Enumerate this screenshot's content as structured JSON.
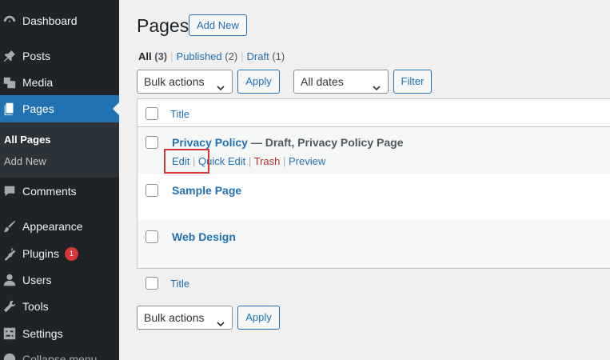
{
  "sidebar": {
    "items": [
      {
        "label": "Dashboard",
        "icon": "dashboard-icon"
      },
      {
        "label": "Posts",
        "icon": "pushpin-icon"
      },
      {
        "label": "Media",
        "icon": "media-icon"
      },
      {
        "label": "Pages",
        "icon": "pages-icon",
        "active": true
      },
      {
        "label": "Comments",
        "icon": "comment-icon"
      },
      {
        "label": "Appearance",
        "icon": "paintbrush-icon"
      },
      {
        "label": "Plugins",
        "icon": "plugin-icon",
        "badge": "1"
      },
      {
        "label": "Users",
        "icon": "user-icon"
      },
      {
        "label": "Tools",
        "icon": "wrench-icon"
      },
      {
        "label": "Settings",
        "icon": "settings-icon"
      },
      {
        "label": "Collapse menu",
        "icon": "collapse-icon"
      }
    ],
    "submenu": [
      {
        "label": "All Pages",
        "current": true
      },
      {
        "label": "Add New"
      }
    ]
  },
  "header": {
    "title": "Pages",
    "add_new": "Add New"
  },
  "filters": {
    "all": {
      "label": "All",
      "count": "(3)"
    },
    "published": {
      "label": "Published",
      "count": "(2)"
    },
    "draft": {
      "label": "Draft",
      "count": "(1)"
    },
    "separator": "|"
  },
  "toolbar": {
    "bulk_actions": "Bulk actions",
    "apply": "Apply",
    "dates": "All dates",
    "filter": "Filter"
  },
  "table": {
    "column_title": "Title",
    "rows": [
      {
        "title": "Privacy Policy",
        "state": "— Draft, Privacy Policy Page",
        "actions": {
          "edit": "Edit",
          "quick_edit": "Quick Edit",
          "trash": "Trash",
          "preview": "Preview"
        }
      },
      {
        "title": "Sample Page"
      },
      {
        "title": "Web Design"
      }
    ]
  },
  "colors": {
    "accent": "#2271b1",
    "sidebar_bg": "#1d2327",
    "highlight": "#d63638"
  }
}
